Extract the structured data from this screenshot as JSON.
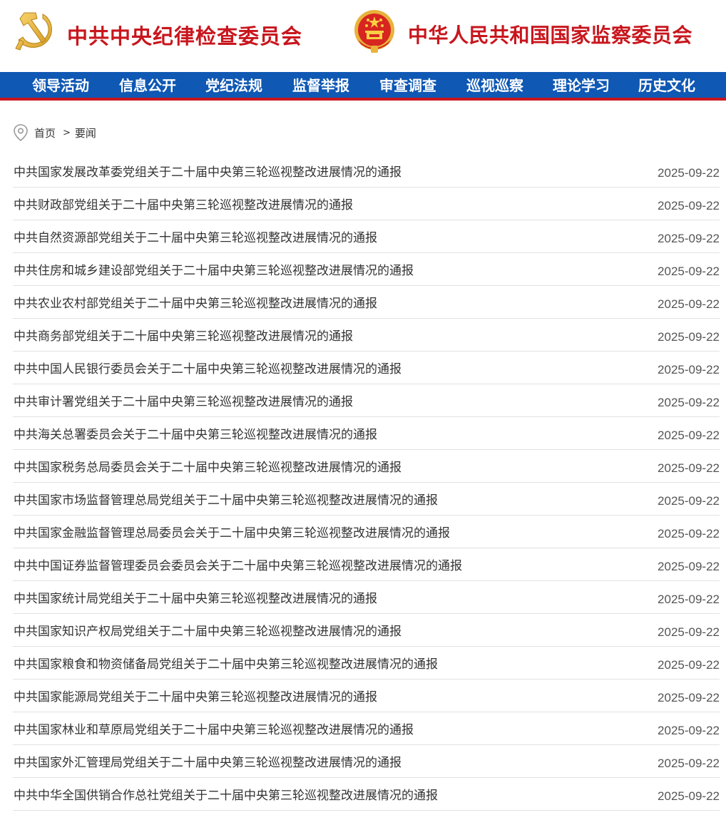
{
  "header": {
    "party_title": "中共中央纪律检查委员会",
    "state_title": "中华人民共和国国家监察委员会",
    "party_emblem_icon": "hammer-sickle-emblem",
    "state_emblem_icon": "national-emblem",
    "brand_red": "#c8161d"
  },
  "nav": {
    "background": "#0f58b4",
    "accent": "#c8161d",
    "items": [
      {
        "label": "领导活动"
      },
      {
        "label": "信息公开"
      },
      {
        "label": "党纪法规"
      },
      {
        "label": "监督举报"
      },
      {
        "label": "审查调查"
      },
      {
        "label": "巡视巡察"
      },
      {
        "label": "理论学习"
      },
      {
        "label": "历史文化"
      }
    ]
  },
  "breadcrumb": {
    "icon": "location-pin-icon",
    "home": "首页",
    "separator": ">",
    "current": "要闻"
  },
  "articles": [
    {
      "title": "中共国家发展改革委党组关于二十届中央第三轮巡视整改进展情况的通报",
      "date": "2025-09-22"
    },
    {
      "title": "中共财政部党组关于二十届中央第三轮巡视整改进展情况的通报",
      "date": "2025-09-22"
    },
    {
      "title": "中共自然资源部党组关于二十届中央第三轮巡视整改进展情况的通报",
      "date": "2025-09-22"
    },
    {
      "title": "中共住房和城乡建设部党组关于二十届中央第三轮巡视整改进展情况的通报",
      "date": "2025-09-22"
    },
    {
      "title": "中共农业农村部党组关于二十届中央第三轮巡视整改进展情况的通报",
      "date": "2025-09-22"
    },
    {
      "title": "中共商务部党组关于二十届中央第三轮巡视整改进展情况的通报",
      "date": "2025-09-22"
    },
    {
      "title": "中共中国人民银行委员会关于二十届中央第三轮巡视整改进展情况的通报",
      "date": "2025-09-22"
    },
    {
      "title": "中共审计署党组关于二十届中央第三轮巡视整改进展情况的通报",
      "date": "2025-09-22"
    },
    {
      "title": "中共海关总署委员会关于二十届中央第三轮巡视整改进展情况的通报",
      "date": "2025-09-22"
    },
    {
      "title": "中共国家税务总局委员会关于二十届中央第三轮巡视整改进展情况的通报",
      "date": "2025-09-22"
    },
    {
      "title": "中共国家市场监督管理总局党组关于二十届中央第三轮巡视整改进展情况的通报",
      "date": "2025-09-22"
    },
    {
      "title": "中共国家金融监督管理总局委员会关于二十届中央第三轮巡视整改进展情况的通报",
      "date": "2025-09-22"
    },
    {
      "title": "中共中国证券监督管理委员会委员会关于二十届中央第三轮巡视整改进展情况的通报",
      "date": "2025-09-22"
    },
    {
      "title": "中共国家统计局党组关于二十届中央第三轮巡视整改进展情况的通报",
      "date": "2025-09-22"
    },
    {
      "title": "中共国家知识产权局党组关于二十届中央第三轮巡视整改进展情况的通报",
      "date": "2025-09-22"
    },
    {
      "title": "中共国家粮食和物资储备局党组关于二十届中央第三轮巡视整改进展情况的通报",
      "date": "2025-09-22"
    },
    {
      "title": "中共国家能源局党组关于二十届中央第三轮巡视整改进展情况的通报",
      "date": "2025-09-22"
    },
    {
      "title": "中共国家林业和草原局党组关于二十届中央第三轮巡视整改进展情况的通报",
      "date": "2025-09-22"
    },
    {
      "title": "中共国家外汇管理局党组关于二十届中央第三轮巡视整改进展情况的通报",
      "date": "2025-09-22"
    },
    {
      "title": "中共中华全国供销合作总社党组关于二十届中央第三轮巡视整改进展情况的通报",
      "date": "2025-09-22"
    }
  ]
}
